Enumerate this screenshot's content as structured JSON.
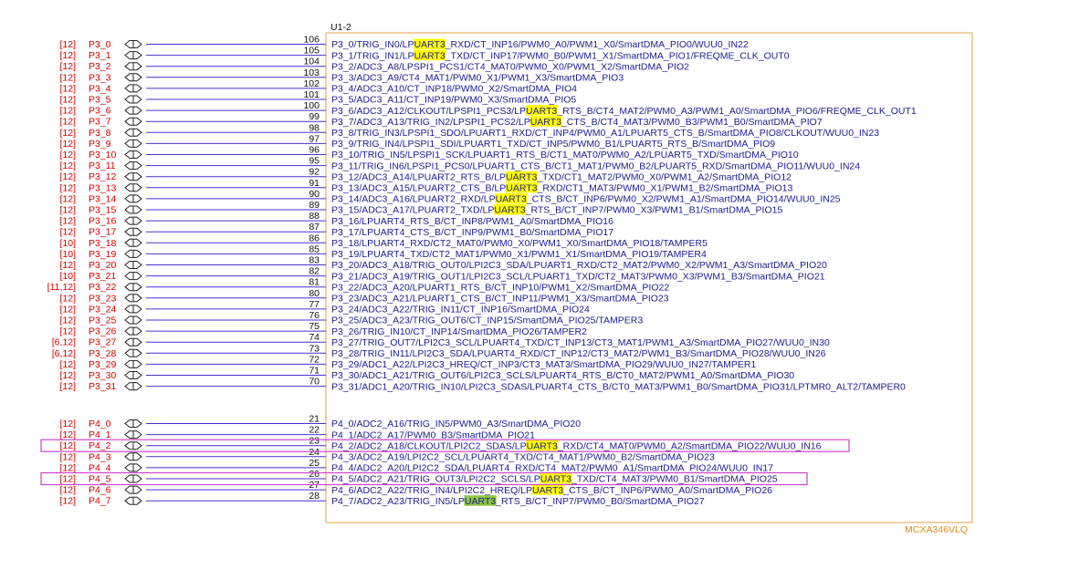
{
  "component": {
    "designator": "U1-2",
    "part_number": "MCXA346VLQ"
  },
  "colors": {
    "net_label": "#d40000",
    "wire": "#4a2fd0",
    "box_border": "#e0a24a",
    "signal_text": "#1c1c8c",
    "highlight_yellow": "#ffff00",
    "highlight_green": "#8cc63f",
    "selection_box": "#cc44cc"
  },
  "groups": [
    {
      "name": "P3",
      "pins": [
        {
          "ref": "[12]",
          "net": "P3_0",
          "pin": "106",
          "signal": "P3_0/TRIG_IN0/LPUART3_RXD/CT_INP16/PWM0_A0/PWM1_X0/SmartDMA_PIO0/WUU0_IN22",
          "hl": "UART3",
          "hl_color": "yellow"
        },
        {
          "ref": "[12]",
          "net": "P3_1",
          "pin": "105",
          "signal": "P3_1/TRIG_IN1/LPUART3_TXD/CT_INP17/PWM0_B0/PWM1_X1/SmartDMA_PIO1/FREQME_CLK_OUT0",
          "hl": "UART3",
          "hl_color": "yellow"
        },
        {
          "ref": "[12]",
          "net": "P3_2",
          "pin": "104",
          "signal": "P3_2/ADC3_A8/LPSPI1_PCS1/CT4_MAT0/PWM0_X0/PWM1_X2/SmartDMA_PIO2"
        },
        {
          "ref": "[12]",
          "net": "P3_3",
          "pin": "103",
          "signal": "P3_3/ADC3_A9/CT4_MAT1/PWM0_X1/PWM1_X3/SmartDMA_PIO3"
        },
        {
          "ref": "[12]",
          "net": "P3_4",
          "pin": "102",
          "signal": "P3_4/ADC3_A10/CT_INP18/PWM0_X2/SmartDMA_PIO4"
        },
        {
          "ref": "[12]",
          "net": "P3_5",
          "pin": "101",
          "signal": "P3_5/ADC3_A11/CT_INP19/PWM0_X3/SmartDMA_PIO5"
        },
        {
          "ref": "[12]",
          "net": "P3_6",
          "pin": "100",
          "signal": "P3_6/ADC3_A12/CLKOUT/LPSPI1_PCS3/LPUART3_RTS_B/CT4_MAT2/PWM0_A3/PWM1_A0/SmartDMA_PIO6/FREQME_CLK_OUT1",
          "hl": "UART3",
          "hl_color": "yellow"
        },
        {
          "ref": "[12]",
          "net": "P3_7",
          "pin": "99",
          "signal": "P3_7/ADC3_A13/TRIG_IN2/LPSPI1_PCS2/LPUART3_CTS_B/CT4_MAT3/PWM0_B3/PWM1_B0/SmartDMA_PIO7",
          "hl": "UART3",
          "hl_color": "yellow"
        },
        {
          "ref": "[12]",
          "net": "P3_8",
          "pin": "98",
          "signal": "P3_8/TRIG_IN3/LPSPI1_SDO/LPUART1_RXD/CT_INP4/PWM0_A1/LPUART5_CTS_B/SmartDMA_PIO8/CLKOUT/WUU0_IN23"
        },
        {
          "ref": "[12]",
          "net": "P3_9",
          "pin": "97",
          "signal": "P3_9/TRIG_IN4/LPSPI1_SDI/LPUART1_TXD/CT_INP5/PWM0_B1/LPUART5_RTS_B/SmartDMA_PIO9"
        },
        {
          "ref": "[12]",
          "net": "P3_10",
          "pin": "96",
          "signal": "P3_10/TRIG_IN5/LPSPI1_SCK/LPUART1_RTS_B/CT1_MAT0/PWM0_A2/LPUART5_TXD/SmartDMA_PIO10"
        },
        {
          "ref": "[12]",
          "net": "P3_11",
          "pin": "95",
          "signal": "P3_11/TRIG_IN6/LPSPI1_PCS0/LPUART1_CTS_B/CT1_MAT1/PWM0_B2/LPUART5_RXD/SmartDMA_PIO11/WUU0_IN24"
        },
        {
          "ref": "[12]",
          "net": "P3_12",
          "pin": "92",
          "signal": "P3_12/ADC3_A14/LPUART2_RTS_B/LPUART3_TXD/CT1_MAT2/PWM0_X0/PWM1_A2/SmartDMA_PIO12",
          "hl": "UART3",
          "hl_color": "yellow"
        },
        {
          "ref": "[12]",
          "net": "P3_13",
          "pin": "91",
          "signal": "P3_13/ADC3_A15/LPUART2_CTS_B/LPUART3_RXD/CT1_MAT3/PWM0_X1/PWM1_B2/SmartDMA_PIO13",
          "hl": "UART3",
          "hl_color": "yellow"
        },
        {
          "ref": "[12]",
          "net": "P3_14",
          "pin": "90",
          "signal": "P3_14/ADC3_A16/LPUART2_RXD/LPUART3_CTS_B/CT_INP6/PWM0_X2/PWM1_A1/SmartDMA_PIO14/WUU0_IN25",
          "hl": "UART3",
          "hl_color": "yellow"
        },
        {
          "ref": "[12]",
          "net": "P3_15",
          "pin": "89",
          "signal": "P3_15/ADC3_A17/LPUART2_TXD/LPUART3_RTS_B/CT_INP7/PWM0_X3/PWM1_B1/SmartDMA_PIO15",
          "hl": "UART3",
          "hl_color": "yellow"
        },
        {
          "ref": "[12]",
          "net": "P3_16",
          "pin": "88",
          "signal": "P3_16/LPUART4_RTS_B/CT_INP8/PWM1_A0/SmartDMA_PIO16"
        },
        {
          "ref": "[12]",
          "net": "P3_17",
          "pin": "87",
          "signal": "P3_17/LPUART4_CTS_B/CT_INP9/PWM1_B0/SmartDMA_PIO17"
        },
        {
          "ref": "[10]",
          "net": "P3_18",
          "pin": "86",
          "signal": "P3_18/LPUART4_RXD/CT2_MAT0/PWM0_X0/PWM1_X0/SmartDMA_PIO18/TAMPER5"
        },
        {
          "ref": "[10]",
          "net": "P3_19",
          "pin": "85",
          "signal": "P3_19/LPUART4_TXD/CT2_MAT1/PWM0_X1/PWM1_X1/SmartDMA_PIO19/TAMPER4"
        },
        {
          "ref": "[12]",
          "net": "P3_20",
          "pin": "83",
          "signal": "P3_20/ADC3_A18/TRIG_OUT0/LPI2C3_SDA/LPUART1_RXD/CT2_MAT2/PWM0_X2/PWM1_A3/SmartDMA_PIO20"
        },
        {
          "ref": "[10]",
          "net": "P3_21",
          "pin": "82",
          "signal": "P3_21/ADC3_A19/TRIG_OUT1/LPI2C3_SCL/LPUART1_TXD/CT2_MAT3/PWM0_X3/PWM1_B3/SmartDMA_PIO21"
        },
        {
          "ref": "[11,12]",
          "net": "P3_22",
          "pin": "81",
          "signal": "P3_22/ADC3_A20/LPUART1_RTS_B/CT_INP10/PWM1_X2/SmartDMA_PIO22"
        },
        {
          "ref": "[12]",
          "net": "P3_23",
          "pin": "80",
          "signal": "P3_23/ADC3_A21/LPUART1_CTS_B/CT_INP11/PWM1_X3/SmartDMA_PIO23"
        },
        {
          "ref": "[12]",
          "net": "P3_24",
          "pin": "77",
          "signal": "P3_24/ADC3_A22/TRIG_IN11/CT_INP16/SmartDMA_PIO24"
        },
        {
          "ref": "[12]",
          "net": "P3_25",
          "pin": "76",
          "signal": "P3_25/ADC3_A23/TRIG_OUT6/CT_INP15/SmartDMA_PIO25/TAMPER3"
        },
        {
          "ref": "[12]",
          "net": "P3_26",
          "pin": "75",
          "signal": "P3_26/TRIG_IN10/CT_INP14/SmartDMA_PIO26/TAMPER2"
        },
        {
          "ref": "[6,12]",
          "net": "P3_27",
          "pin": "74",
          "signal": "P3_27/TRIG_OUT7/LPI2C3_SCL/LPUART4_TXD/CT_INP13/CT3_MAT1/PWM1_A3/SmartDMA_PIO27/WUU0_IN30"
        },
        {
          "ref": "[6,12]",
          "net": "P3_28",
          "pin": "73",
          "signal": "P3_28/TRIG_IN11/LPI2C3_SDA/LPUART4_RXD/CT_INP12/CT3_MAT2/PWM1_B3/SmartDMA_PIO28/WUU0_IN26"
        },
        {
          "ref": "[12]",
          "net": "P3_29",
          "pin": "72",
          "signal": "P3_29/ADC1_A22/LPI2C3_HREQ/CT_INP3/CT3_MAT3/SmartDMA_PIO29/WUU0_IN27/TAMPER1"
        },
        {
          "ref": "[12]",
          "net": "P3_30",
          "pin": "71",
          "signal": "P3_30/ADC1_A21/TRIG_OUT6/LPI2C3_SCLS/LPUART4_RTS_B/CT0_MAT2/PWM1_A0/SmartDMA_PIO30"
        },
        {
          "ref": "[12]",
          "net": "P3_31",
          "pin": "70",
          "signal": "P3_31/ADC1_A20/TRIG_IN10/LPI2C3_SDAS/LPUART4_CTS_B/CT0_MAT3/PWM1_B0/SmartDMA_PIO31/LPTMR0_ALT2/TAMPER0"
        }
      ]
    },
    {
      "name": "P4",
      "pins": [
        {
          "ref": "[12]",
          "net": "P4_0",
          "pin": "21",
          "signal": "P4_0/ADC2_A16/TRIG_IN5/PWM0_A3/SmartDMA_PIO20"
        },
        {
          "ref": "[12]",
          "net": "P4_1",
          "pin": "22",
          "signal": "P4_1/ADC2_A17/PWM0_B3/SmartDMA_PIO21"
        },
        {
          "ref": "[12]",
          "net": "P4_2",
          "pin": "23",
          "signal": "P4_2/ADC2_A18/CLKOUT/LPI2C2_SDAS/LPUART3_RXD/CT4_MAT0/PWM0_A2/SmartDMA_PIO22/WUU0_IN16",
          "hl": "UART3",
          "hl_color": "yellow",
          "selected": true
        },
        {
          "ref": "[12]",
          "net": "P4_3",
          "pin": "24",
          "signal": "P4_3/ADC2_A19/LPI2C2_SCL/LPUART4_TXD/CT4_MAT1/PWM0_B2/SmartDMA_PIO23"
        },
        {
          "ref": "[12]",
          "net": "P4_4",
          "pin": "25",
          "signal": "P4_4/ADC2_A20/LPI2C2_SDA/LPUART4_RXD/CT4_MAT2/PWM0_A1/SmartDMA_PIO24/WUU0_IN17"
        },
        {
          "ref": "[12]",
          "net": "P4_5",
          "pin": "26",
          "signal": "P4_5/ADC2_A21/TRIG_OUT3/LPI2C2_SCLS/LPUART3_TXD/CT4_MAT3/PWM0_B1/SmartDMA_PIO25",
          "hl": "UART3",
          "hl_color": "yellow",
          "selected": true
        },
        {
          "ref": "[12]",
          "net": "P4_6",
          "pin": "27",
          "signal": "P4_6/ADC2_A22/TRIG_IN4/LPI2C2_HREQ/LPUART3_CTS_B/CT_INP6/PWM0_A0/SmartDMA_PIO26",
          "hl": "UART3",
          "hl_color": "yellow"
        },
        {
          "ref": "[12]",
          "net": "P4_7",
          "pin": "28",
          "signal": "P4_7/ADC2_A23/TRIG_IN5/LPUART3_RTS_B/CT_INP7/PWM0_B0/SmartDMA_PIO27",
          "hl": "UART3",
          "hl_color": "green"
        }
      ]
    }
  ]
}
